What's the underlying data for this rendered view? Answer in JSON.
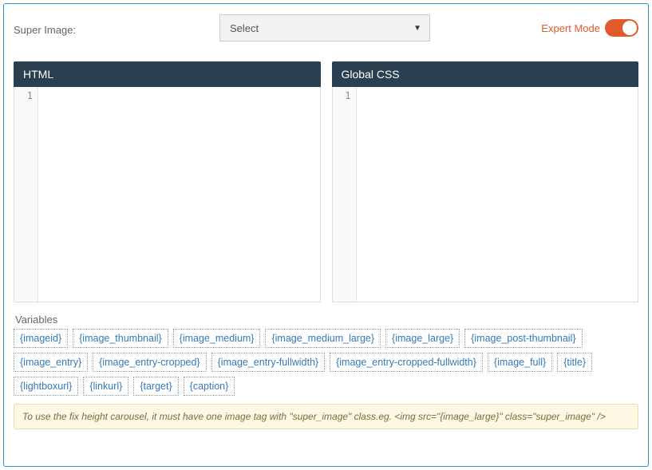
{
  "topRow": {
    "label": "Super Image:",
    "selectValue": "Select",
    "expertLabel": "Expert Mode"
  },
  "editors": {
    "left": {
      "title": "HTML",
      "lineNum": "1"
    },
    "right": {
      "title": "Global CSS",
      "lineNum": "1"
    }
  },
  "variablesLabel": "Variables",
  "chips": [
    "{imageid}",
    "{image_thumbnail}",
    "{image_medium}",
    "{image_medium_large}",
    "{image_large}",
    "{image_post-thumbnail}",
    "{image_entry}",
    "{image_entry-cropped}",
    "{image_entry-fullwidth}",
    "{image_entry-cropped-fullwidth}",
    "{image_full}",
    "{title}",
    "{lightboxurl}",
    "{linkurl}",
    "{target}",
    "{caption}"
  ],
  "infoText": "To use the fix height carousel, it must have one image tag with \"super_image\" class.eg. <img src=\"{image_large}\" class=\"super_image\" />"
}
